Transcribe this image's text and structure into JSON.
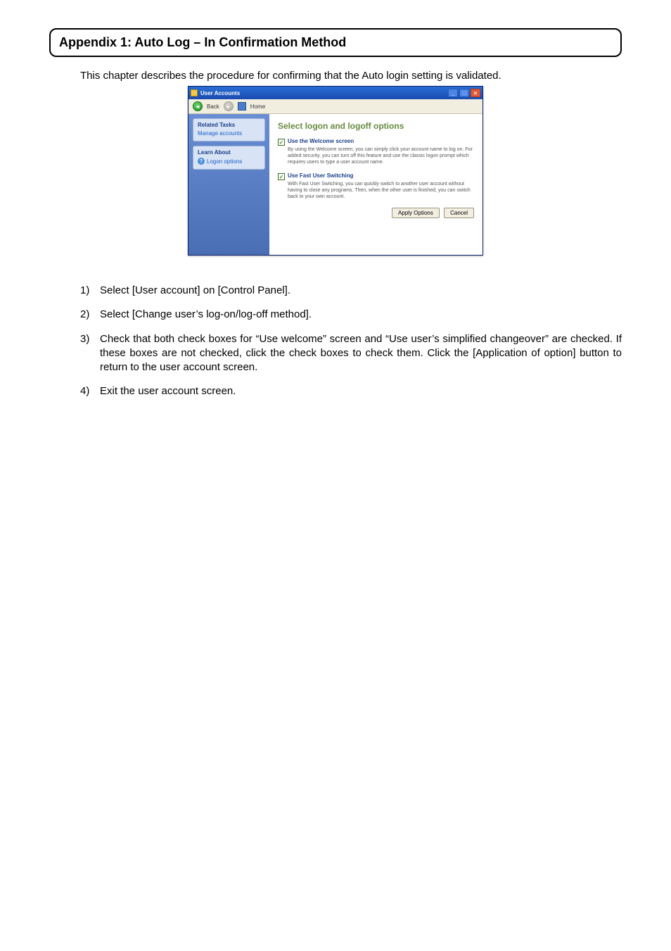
{
  "heading": "Appendix 1: Auto Log – In Confirmation Method",
  "intro": "This chapter describes the procedure for confirming that the Auto login setting is validated.",
  "xp": {
    "title": "User Accounts",
    "back_label": "Back",
    "home_label": "Home",
    "sidebar": {
      "related_hdr": "Related Tasks",
      "related_link": "Manage accounts",
      "learn_hdr": "Learn About",
      "learn_link": "Logon options"
    },
    "content_title": "Select logon and logoff options",
    "opt1_label": "Use the Welcome screen",
    "opt1_desc": "By using the Welcome screen, you can simply click your account name to log on. For added security, you can turn off this feature and use the classic logon prompt which requires users to type a user account name.",
    "opt2_label": "Use Fast User Switching",
    "opt2_desc": "With Fast User Switching, you can quickly switch to another user account without having to close any programs. Then, when the other user is finished, you can switch back to your own account.",
    "apply_btn": "Apply Options",
    "cancel_btn": "Cancel"
  },
  "steps": {
    "s1_num": "1)",
    "s1_txt": "Select [User account] on [Control Panel].",
    "s2_num": "2)",
    "s2_txt": "Select [Change user’s log-on/log-off method].",
    "s3_num": "3)",
    "s3_txt": "Check that both check boxes for “Use welcome” screen and “Use user’s simplified changeover” are checked. If these boxes are not checked, click the check boxes to check them. Click the [Application of option] button to return to the user account screen.",
    "s4_num": "4)",
    "s4_txt": "Exit the user account screen."
  }
}
